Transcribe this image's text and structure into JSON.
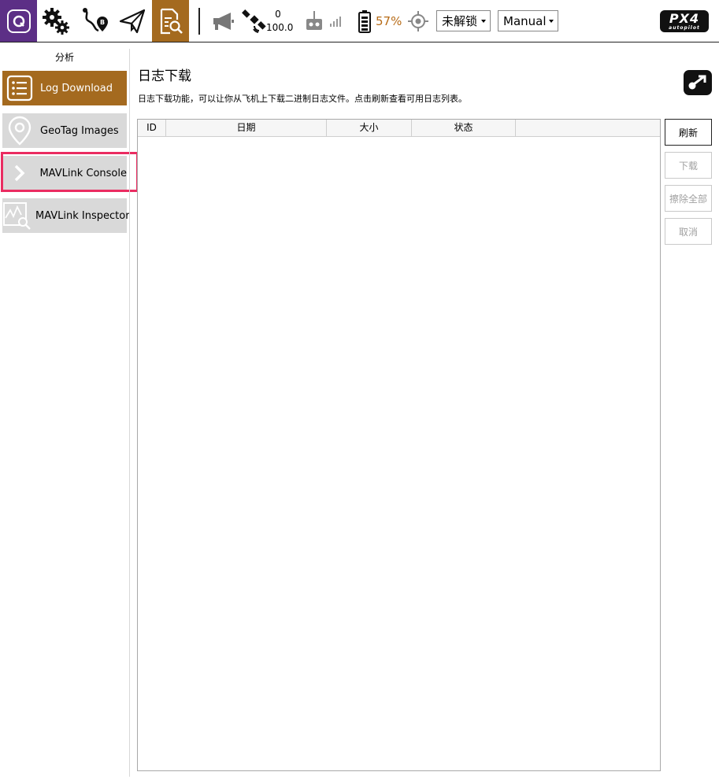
{
  "toolbar": {
    "gps_count": "0",
    "gps_hdop": "100.0",
    "battery_percent": "57%",
    "arm_status": "未解锁",
    "flight_mode": "Manual",
    "px4_logo_text": "PX4",
    "px4_logo_sub": "autopilot",
    "colors": {
      "app_purple": "#5c2f86",
      "accent_brown": "#a46a1f",
      "battery": "#b76b17"
    }
  },
  "sidebar": {
    "title": "分析",
    "items": [
      {
        "label": "Log Download",
        "icon": "list-icon",
        "active": true
      },
      {
        "label": "GeoTag Images",
        "icon": "map-pin-icon",
        "active": false
      },
      {
        "label": "MAVLink Console",
        "icon": "chevron-right-icon",
        "active": false
      },
      {
        "label": "MAVLink Inspector",
        "icon": "chart-search-icon",
        "active": false
      }
    ]
  },
  "main": {
    "title": "日志下载",
    "description": "日志下载功能，可以让你从飞机上下载二进制日志文件。点击刷新查看可用日志列表。",
    "table": {
      "columns": [
        "ID",
        "日期",
        "大小",
        "状态"
      ],
      "rows": []
    },
    "buttons": {
      "refresh": "刷新",
      "download": "下载",
      "erase_all": "擦除全部",
      "cancel": "取消"
    }
  }
}
